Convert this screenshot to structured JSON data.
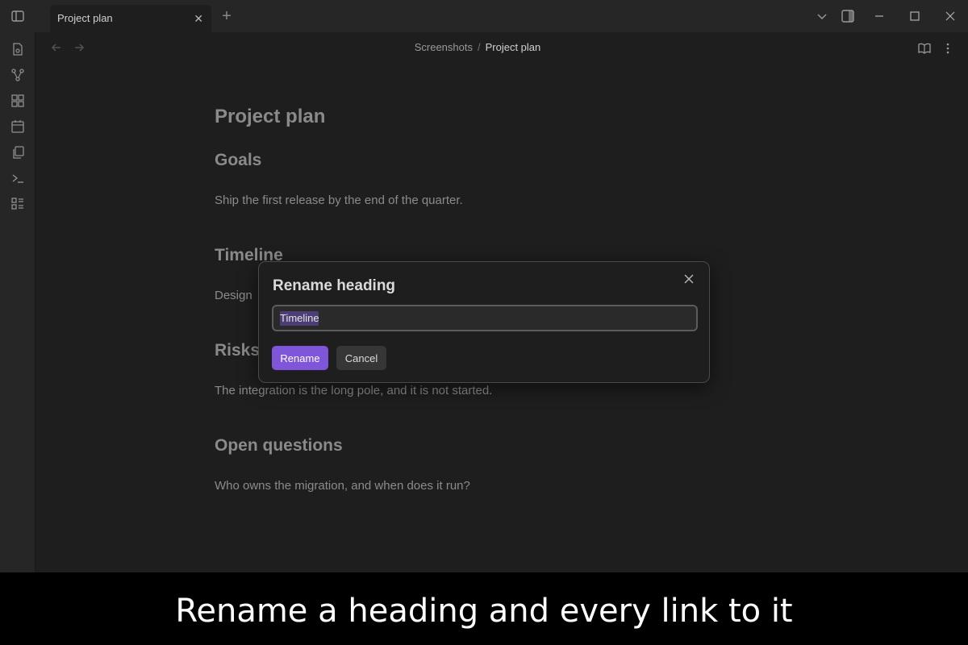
{
  "tab": {
    "title": "Project plan"
  },
  "breadcrumb": {
    "folder": "Screenshots",
    "separator": "/",
    "current": "Project plan"
  },
  "document": {
    "title": "Project plan",
    "sections": [
      {
        "heading": "Goals",
        "body": "Ship the first release by the end of the quarter."
      },
      {
        "heading": "Timeline",
        "body": "Design"
      },
      {
        "heading": "Risks",
        "body": "The integration is the long pole, and it is not started."
      },
      {
        "heading": "Open questions",
        "body": "Who owns the migration, and when does it run?"
      }
    ]
  },
  "dialog": {
    "title": "Rename heading",
    "input_value": "Timeline",
    "confirm_label": "Rename",
    "cancel_label": "Cancel"
  },
  "caption": "Rename a heading and every link to it",
  "colors": {
    "accent": "#7f56d9",
    "selection": "#4c3d74"
  },
  "icons": [
    "sidebar-toggle-icon",
    "new-tab-icon",
    "chevron-down-icon",
    "right-sidebar-icon",
    "minimize-icon",
    "maximize-icon",
    "close-window-icon",
    "file-icon",
    "graph-icon",
    "grid-icon",
    "calendar-icon",
    "copy-icon",
    "terminal-icon",
    "list-icon",
    "back-arrow-icon",
    "forward-arrow-icon",
    "reading-view-icon",
    "more-options-icon",
    "close-icon"
  ]
}
